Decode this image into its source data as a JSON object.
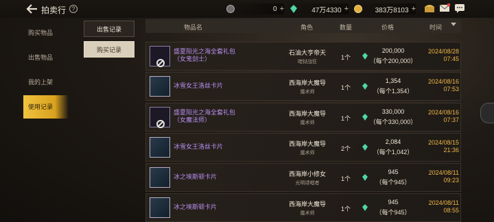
{
  "header": {
    "title": "拍卖行",
    "help": "?",
    "currencies": [
      {
        "icon": "coin-c-icon",
        "value": "0"
      },
      {
        "icon": "green-gem-icon",
        "value": "47万4330"
      },
      {
        "icon": "gold-coin-icon",
        "value": "383万8103"
      }
    ],
    "plus": "+"
  },
  "sidebar": {
    "items": [
      {
        "label": "购买物品"
      },
      {
        "label": "出售物品"
      },
      {
        "label": "我的上架"
      },
      {
        "label": "使用记录"
      }
    ]
  },
  "subtabs": {
    "sell": "出售记录",
    "buy": "购买记录"
  },
  "table": {
    "headers": {
      "name": "物品名",
      "role": "角色",
      "qty": "数量",
      "price": "价格",
      "time": "时间"
    },
    "rows": [
      {
        "name1": "盛夏阳光之海全套礼包",
        "name2": "（女鬼剑士）",
        "role": "石油大亨帝天",
        "role_sub": "暗狱战狂",
        "qty": "1个",
        "price": "200,000",
        "unit": "（每个200,000）",
        "date": "2024/08/28",
        "time": "07:45"
      },
      {
        "name1": "冰雪女王洛丝卡片",
        "name2": "",
        "role": "西海岸大魔导",
        "role_sub": "魔术师",
        "qty": "1个",
        "price": "1,354",
        "unit": "（每个1,354）",
        "date": "2024/08/16",
        "time": "07:53"
      },
      {
        "name1": "盛夏阳光之海全套礼包",
        "name2": "（女魔法师）",
        "role": "西海岸大魔导",
        "role_sub": "魔术师",
        "qty": "1个",
        "price": "330,000",
        "unit": "（每个330,000）",
        "date": "2024/08/16",
        "time": "07:37"
      },
      {
        "name1": "冰雪女王洛丝卡片",
        "name2": "",
        "role": "西海岸大魔导",
        "role_sub": "魔术师",
        "qty": "2个",
        "price": "2,084",
        "unit": "（每个1,042）",
        "date": "2024/08/15",
        "time": "21:36"
      },
      {
        "name1": "冰之埃斯顿卡片",
        "name2": "",
        "role": "西海岸小修女",
        "role_sub": "光明颂唱者",
        "qty": "1个",
        "price": "945",
        "unit": "（每个945）",
        "date": "2024/08/11",
        "time": "09:23"
      },
      {
        "name1": "冰之埃斯顿卡片",
        "name2": "",
        "role": "西海岸大魔导",
        "role_sub": "魔术师",
        "qty": "1个",
        "price": "945",
        "unit": "（每个945）",
        "date": "2024/08/11",
        "time": "08:55"
      }
    ]
  },
  "colors": {
    "accent": "#f0c23e",
    "item_purple": "#b88ff0",
    "date_orange": "#f0b648"
  }
}
